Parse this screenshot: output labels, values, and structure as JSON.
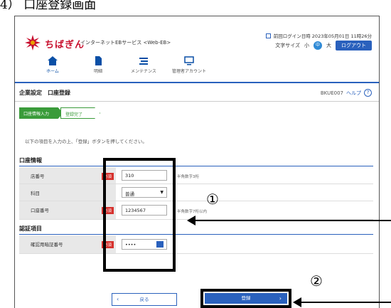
{
  "doc": {
    "heading": "4） 口座登録画面"
  },
  "header": {
    "brand": "ちばぎん",
    "service": "インターネットEBサービス <Web-EB>",
    "last_login": "前回ログイン日時 2023年05月01日 11時26分",
    "font_size_label": "文字サイズ",
    "font_small": "小",
    "font_mid": "中",
    "font_large": "大",
    "logout": "ログアウト"
  },
  "gnav": [
    {
      "label": "ホーム",
      "icon": "home-icon"
    },
    {
      "label": "明細",
      "icon": "document-icon"
    },
    {
      "label": "メンテナンス",
      "icon": "maintenance-icon"
    },
    {
      "label": "管理者アカウント",
      "icon": "monitor-icon"
    }
  ],
  "page": {
    "title": "企業設定　口座登録",
    "screen_id": "BKUE007",
    "help": "ヘルプ",
    "steps": [
      "口座情報入力",
      "登録完了"
    ],
    "instruction": "以下の項目を入力の上、「登録」ボタンを押してください。"
  },
  "account_section": {
    "title": "口座情報",
    "fields": [
      {
        "label": "店番号",
        "required": "必須",
        "value": "310",
        "hint": "半角数字3桁"
      },
      {
        "label": "科目",
        "required": "",
        "value": "普通",
        "hint": ""
      },
      {
        "label": "口座番号",
        "required": "必須",
        "value": "1234567",
        "hint": "半角数字7桁以内"
      }
    ]
  },
  "auth_section": {
    "title": "認証項目",
    "fields": [
      {
        "label": "確認用暗証番号",
        "required": "必須",
        "value": "••••"
      }
    ]
  },
  "buttons": {
    "back": "戻る",
    "next": "登録"
  },
  "callouts": {
    "c1": "①",
    "c2": "②"
  }
}
